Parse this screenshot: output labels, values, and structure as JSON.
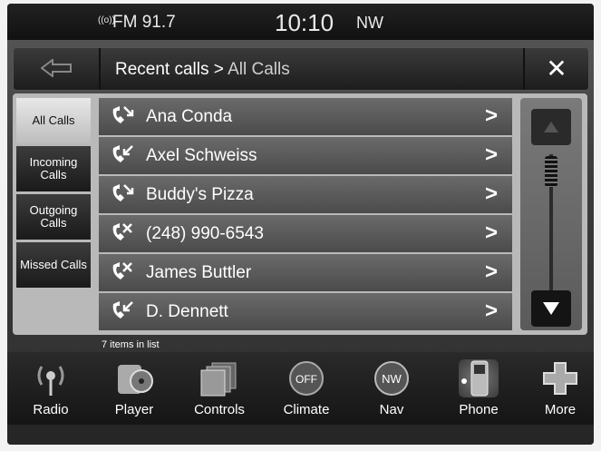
{
  "status": {
    "radio_icon": "((o))",
    "station": "FM 91.7",
    "time": "10:10",
    "compass": "NW"
  },
  "header": {
    "breadcrumb_main": "Recent calls",
    "breadcrumb_sep": " > ",
    "breadcrumb_sub": "All Calls",
    "close_label": "✕"
  },
  "filters": [
    {
      "label": "All Calls"
    },
    {
      "label": "Incoming Calls"
    },
    {
      "label": "Outgoing Calls"
    },
    {
      "label": "Missed Calls"
    }
  ],
  "calls": [
    {
      "name": "Ana Conda",
      "type": "outgoing"
    },
    {
      "name": "Axel Schweiss",
      "type": "incoming"
    },
    {
      "name": "Buddy's Pizza",
      "type": "outgoing"
    },
    {
      "name": "(248) 990-6543",
      "type": "missed"
    },
    {
      "name": "James Buttler",
      "type": "missed"
    },
    {
      "name": "D. Dennett",
      "type": "incoming"
    }
  ],
  "list_count": "7 items in list",
  "nav": [
    {
      "label": "Radio",
      "icon": "radio-icon"
    },
    {
      "label": "Player",
      "icon": "player-icon"
    },
    {
      "label": "Controls",
      "icon": "controls-icon"
    },
    {
      "label": "Climate",
      "icon": "climate-icon",
      "icon_text": "OFF"
    },
    {
      "label": "Nav",
      "icon": "nav-icon",
      "icon_text": "NW"
    },
    {
      "label": "Phone",
      "icon": "phone-icon"
    },
    {
      "label": "More",
      "icon": "more-icon"
    }
  ],
  "colors": {
    "active_filter": "#d8d8d8",
    "row": "#5a5a5a",
    "panel": "#b9b9b9"
  }
}
